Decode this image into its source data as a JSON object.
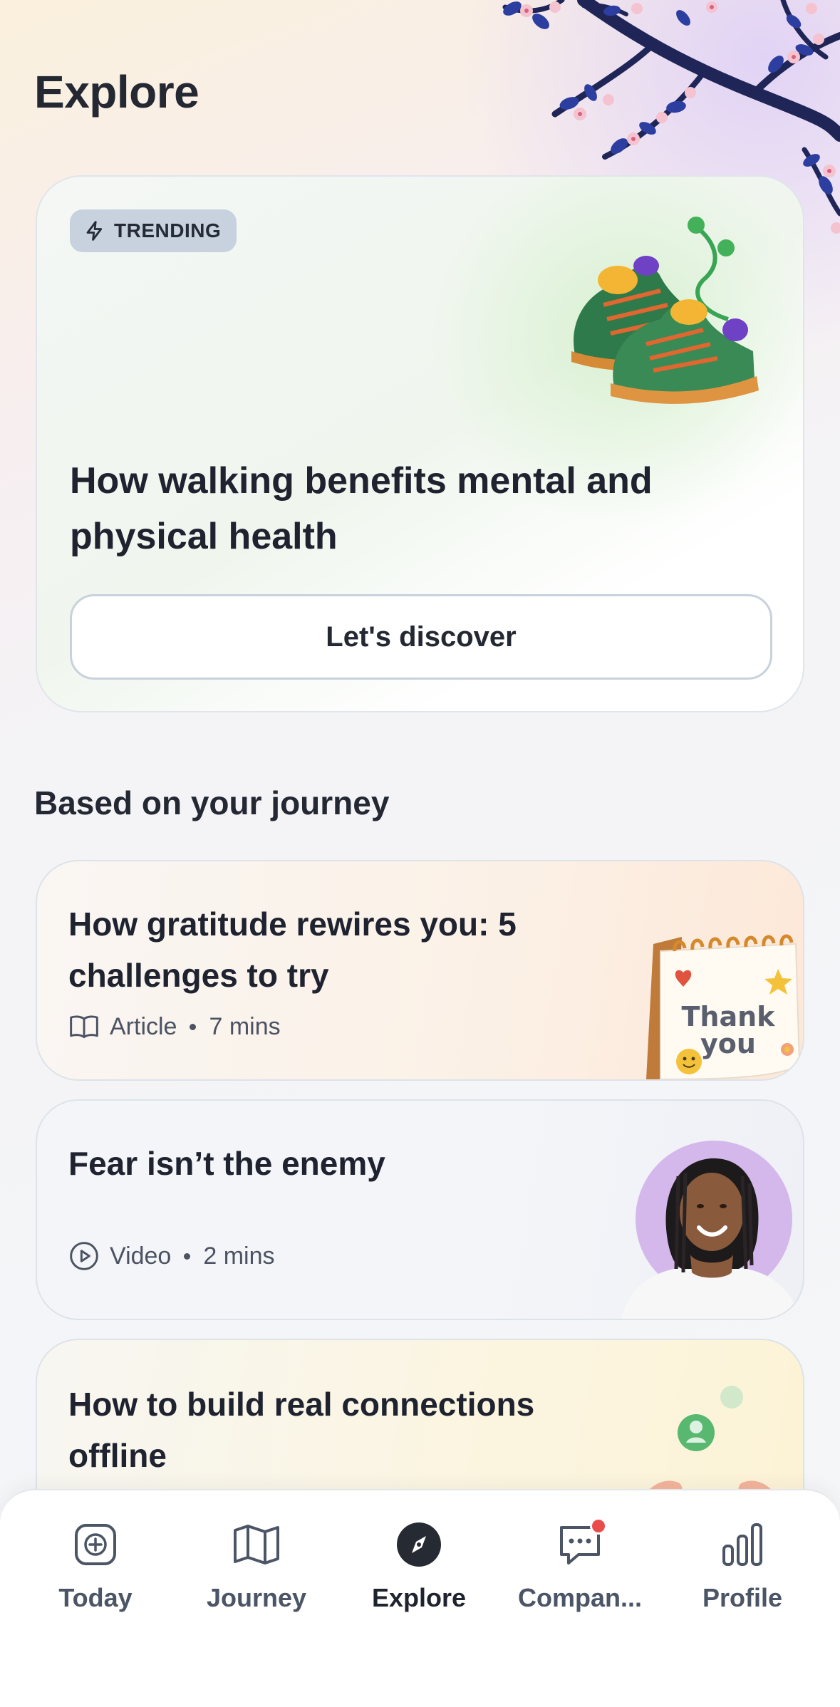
{
  "header": {
    "title": "Explore"
  },
  "hero": {
    "badge": "TRENDING",
    "title": "How walking benefits mental and physical health",
    "button_label": "Let's discover"
  },
  "section": {
    "title": "Based on your journey"
  },
  "recommendations": [
    {
      "title": "How gratitude rewires you: 5 challenges to try",
      "type": "Article",
      "duration": "7 mins",
      "icon": "book-open-icon"
    },
    {
      "title": "Fear isn’t the enemy",
      "type": "Video",
      "duration": "2 mins",
      "icon": "play-circle-icon"
    },
    {
      "title": "How to build real connections offline"
    }
  ],
  "tabbar": {
    "items": [
      {
        "label": "Today",
        "icon": "plus-square-icon"
      },
      {
        "label": "Journey",
        "icon": "map-icon"
      },
      {
        "label": "Explore",
        "icon": "compass-icon",
        "active": true
      },
      {
        "label": "Compan...",
        "icon": "chat-bubble-icon",
        "has_notification": true
      },
      {
        "label": "Profile",
        "icon": "bar-chart-icon"
      }
    ]
  },
  "colors": {
    "notification": "#ea4c4c",
    "badge_bg": "#c7d2de",
    "text_dark": "#1f2330"
  }
}
